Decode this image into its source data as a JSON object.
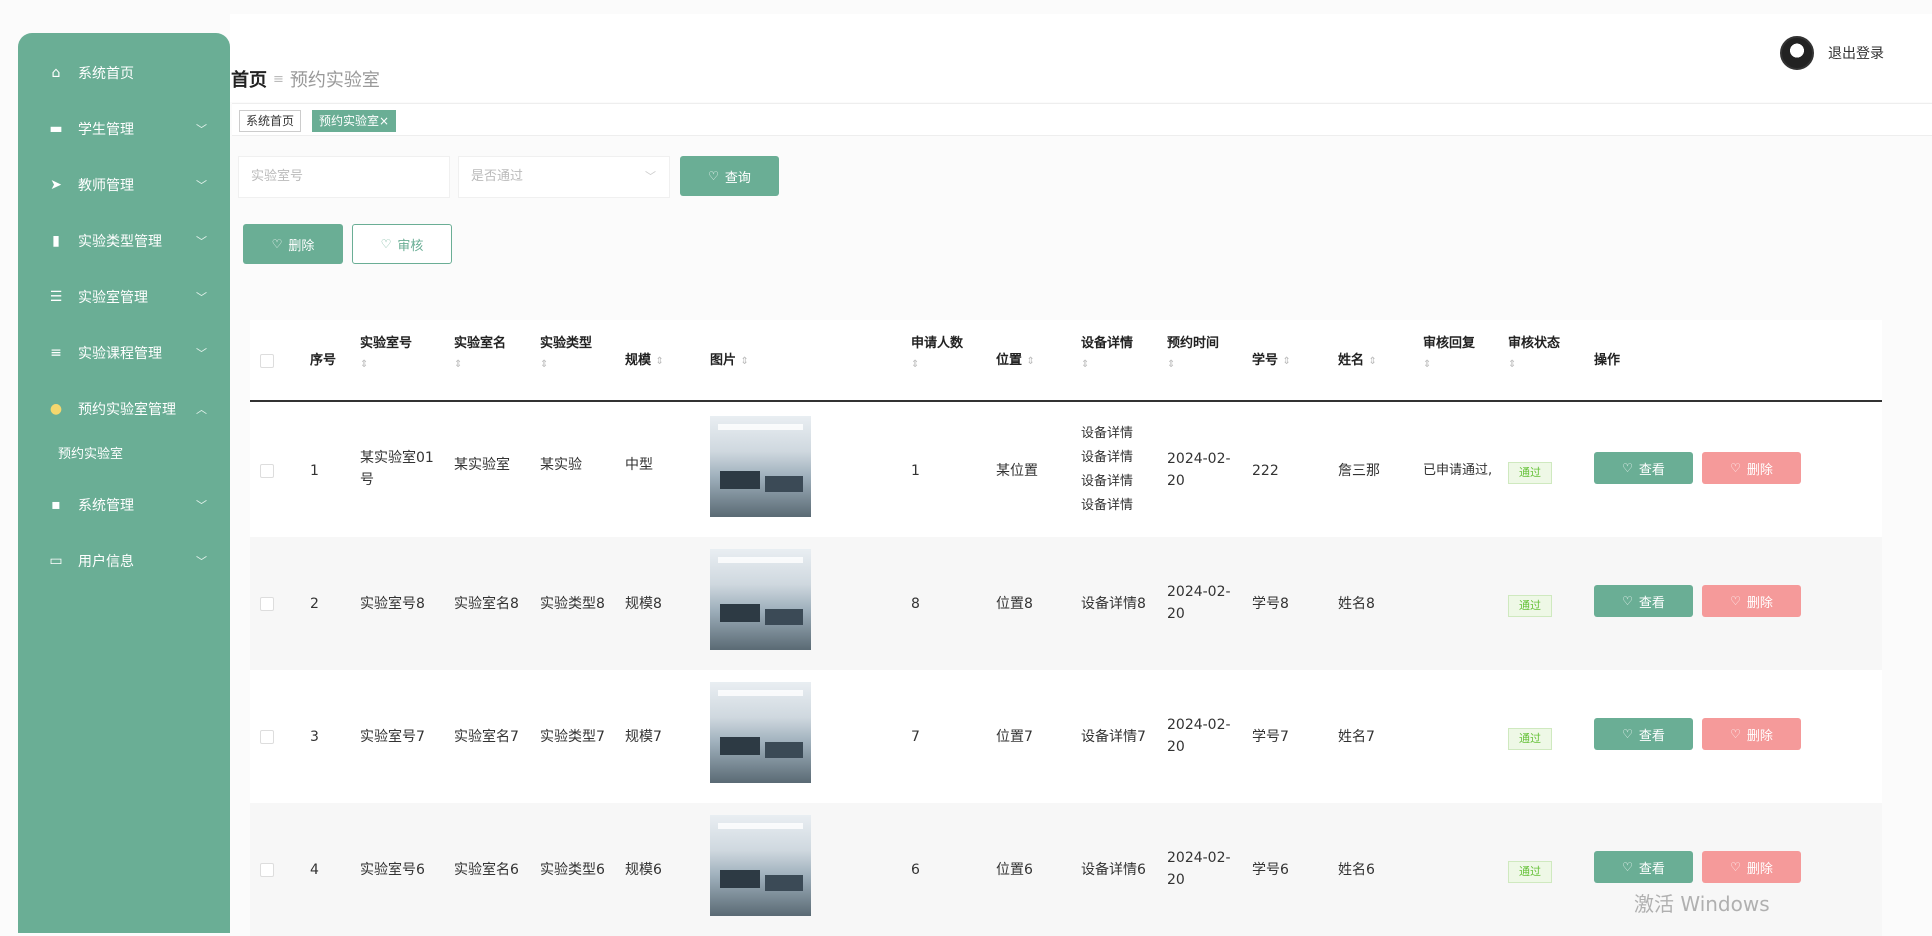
{
  "sidebar": {
    "items": [
      {
        "label": "系统首页",
        "icon": "home-icon",
        "glyph": "⌂"
      },
      {
        "label": "学生管理",
        "icon": "monitor-icon",
        "glyph": "▬"
      },
      {
        "label": "教师管理",
        "icon": "send-icon",
        "glyph": "➤"
      },
      {
        "label": "实验类型管理",
        "icon": "chart-icon",
        "glyph": "▮"
      },
      {
        "label": "实验室管理",
        "icon": "list-icon",
        "glyph": "☰"
      },
      {
        "label": "实验课程管理",
        "icon": "sliders-icon",
        "glyph": "≡"
      },
      {
        "label": "预约实验室管理",
        "icon": "bulb-icon",
        "glyph": "●"
      },
      {
        "label": "系统管理",
        "icon": "message-icon",
        "glyph": "▪"
      },
      {
        "label": "用户信息",
        "icon": "window-icon",
        "glyph": "▭"
      }
    ],
    "sub_item": "预约实验室"
  },
  "header": {
    "crumb_home": "首页",
    "crumb_sep": "≡",
    "crumb_current": "预约实验室",
    "logout": "退出登录"
  },
  "tabs": [
    "系统首页",
    "预约实验室×"
  ],
  "search": {
    "room_placeholder": "实验室号",
    "pass_placeholder": "是否通过",
    "query_label": "查询"
  },
  "actions": {
    "delete_label": "删除",
    "audit_label": "审核"
  },
  "table": {
    "headers": [
      "序号",
      "实验室号",
      "实验室名",
      "实验类型",
      "规模",
      "图片",
      "申请人数",
      "位置",
      "设备详情",
      "预约时间",
      "学号",
      "姓名",
      "审核回复",
      "审核状态",
      "操作"
    ],
    "rows": [
      {
        "no": "1",
        "room_no_1": "某实验室01",
        "room_no_2": "号",
        "room_name": "某实验室",
        "type": "某实验",
        "scale": "中型",
        "count": "1",
        "location": "某位置",
        "equip": [
          "设备详情",
          "设备详情",
          "设备详情",
          "设备详情"
        ],
        "date_1": "2024-02-",
        "date_2": "20",
        "student_no": "222",
        "name": "詹三那",
        "reply": "已申请通过,",
        "status": "通过"
      },
      {
        "no": "2",
        "room_no_1": "实验室号8",
        "room_no_2": "",
        "room_name": "实验室名8",
        "type": "实验类型8",
        "scale": "规模8",
        "count": "8",
        "location": "位置8",
        "equip": [
          "设备详情8"
        ],
        "date_1": "2024-02-",
        "date_2": "20",
        "student_no": "学号8",
        "name": "姓名8",
        "reply": "",
        "status": "通过"
      },
      {
        "no": "3",
        "room_no_1": "实验室号7",
        "room_no_2": "",
        "room_name": "实验室名7",
        "type": "实验类型7",
        "scale": "规模7",
        "count": "7",
        "location": "位置7",
        "equip": [
          "设备详情7"
        ],
        "date_1": "2024-02-",
        "date_2": "20",
        "student_no": "学号7",
        "name": "姓名7",
        "reply": "",
        "status": "通过"
      },
      {
        "no": "4",
        "room_no_1": "实验室号6",
        "room_no_2": "",
        "room_name": "实验室名6",
        "type": "实验类型6",
        "scale": "规模6",
        "count": "6",
        "location": "位置6",
        "equip": [
          "设备详情6"
        ],
        "date_1": "2024-02-",
        "date_2": "20",
        "student_no": "学号6",
        "name": "姓名6",
        "reply": "",
        "status": "通过"
      }
    ],
    "view_label": "查看",
    "row_delete_label": "删除"
  },
  "watermark": "激活 Windows",
  "colors": {
    "accent": "#6aae95",
    "danger": "#f59a9a",
    "success": "#67c23a"
  }
}
